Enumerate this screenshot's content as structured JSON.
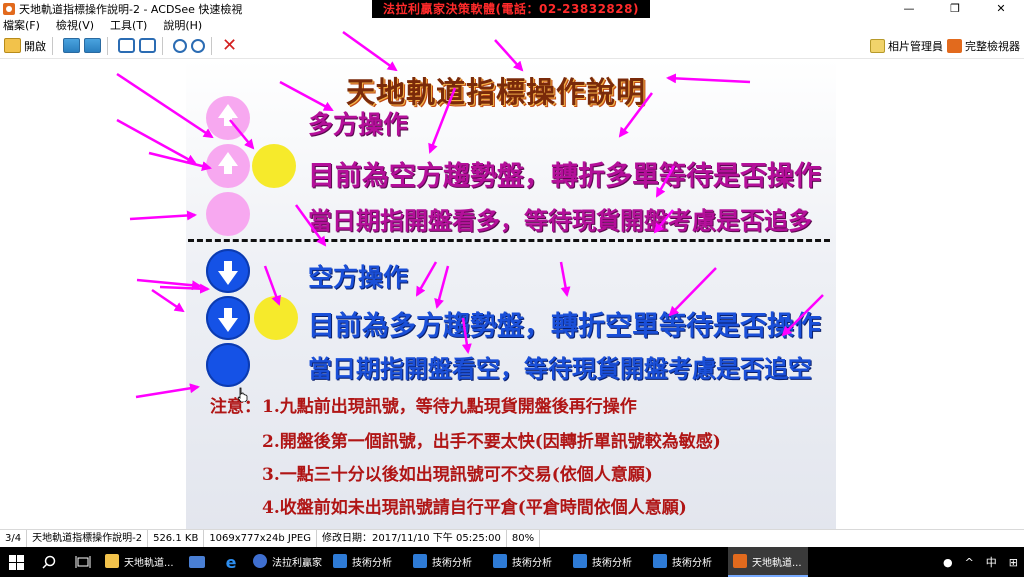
{
  "window": {
    "title": "天地軌道指標操作說明-2 - ACDSee 快速檢視",
    "banner": "法拉利贏家決策軟體(電話：02-23832828)",
    "controls": [
      "—",
      "❐",
      "✕"
    ]
  },
  "menu": [
    "檔案(F)",
    "檢視(V)",
    "工具(T)",
    "說明(H)"
  ],
  "toolbar": {
    "open_label": "開啟",
    "photo_manager_label": "相片管理員",
    "full_viewer_label": "完整檢視器"
  },
  "slide": {
    "title": "天地軌道指標操作說明",
    "long_heading": "多方操作",
    "long_line1": "目前為空方趨勢盤，轉折多單等待是否操作",
    "long_line2": "當日期指開盤看多，等待現貨開盤考慮是否追多",
    "short_heading": "空方操作",
    "short_line1": "目前為多方趨勢盤，轉折空單等待是否操作",
    "short_line2": "當日期指開盤看空，等待現貨開盤考慮是否追空",
    "note_label": "注意：",
    "notes": [
      "1.九點前出現訊號，等待九點現貨開盤後再行操作",
      "2.開盤後第一個訊號，出手不要太快(因轉折單訊號較為敏感)",
      "3.一點三十分以後如出現訊號可不交易(依個人意願)",
      "4.收盤前如未出現訊號請自行平倉(平倉時間依個人意願)"
    ],
    "colors": {
      "pink": "#f7a8f0",
      "blue": "#1552e6",
      "yellow": "#f6ea2b",
      "arrow": "#ff00ff"
    }
  },
  "status": {
    "index": "3/4",
    "filename": "天地軌道指標操作說明-2",
    "size": "526.1 KB",
    "dims": "1069x777x24b JPEG",
    "modified": "修改日期：2017/11/10 下午 05:25:00",
    "zoom": "80%"
  },
  "taskbar": {
    "items": [
      "天地軌道...",
      "",
      "",
      "法拉利贏家",
      "技術分析",
      "技術分析",
      "技術分析",
      "技術分析",
      "技術分析",
      "天地軌道..."
    ],
    "tray": [
      "^",
      "中",
      "⊞"
    ]
  }
}
